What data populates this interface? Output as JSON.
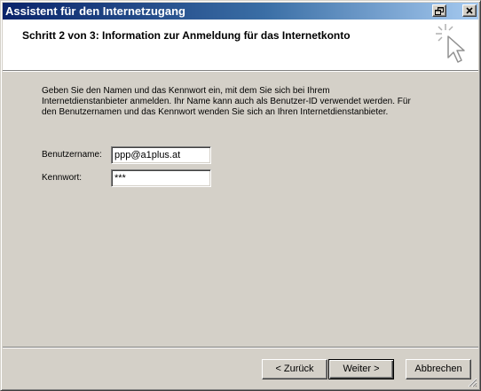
{
  "window": {
    "title": "Assistent für den Internetzugang",
    "controls": {
      "restore_icon": "restore-icon",
      "close_icon": "close-icon"
    }
  },
  "header": {
    "step_title": "Schritt 2 von 3: Information zur Anmeldung für das Internetkonto",
    "icon": "wizard-cursor-sparkle-icon"
  },
  "body": {
    "description": "Geben Sie den Namen und das Kennwort ein, mit dem Sie sich bei Ihrem Internetdienstanbieter anmelden. Ihr Name kann auch als Benutzer-ID verwendet werden. Für den Benutzernamen und das Kennwort wenden Sie sich an Ihren Internetdienstanbieter.",
    "username": {
      "label": "Benutzername:",
      "value": "ppp@a1plus.at"
    },
    "password": {
      "label": "Kennwort:",
      "value": "***"
    }
  },
  "footer": {
    "back_label": "< Zurück",
    "next_label": "Weiter >",
    "cancel_label": "Abbrechen"
  },
  "colors": {
    "titlebar_start": "#0a246a",
    "titlebar_end": "#a6caf0",
    "dialog_face": "#d4d0c8",
    "header_bg": "#ffffff"
  }
}
